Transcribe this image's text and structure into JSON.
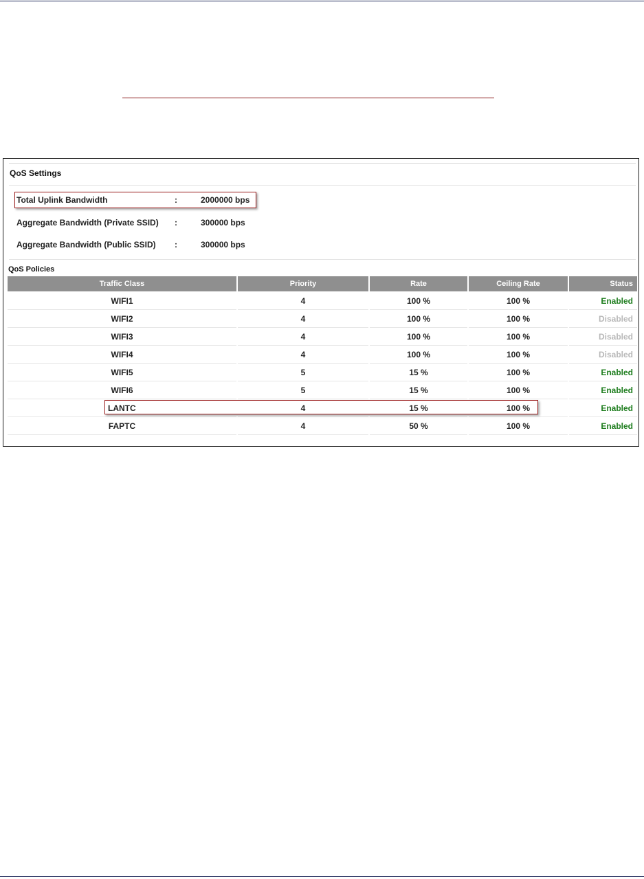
{
  "panel": {
    "title": "QoS Settings"
  },
  "settings": [
    {
      "label": "Total Uplink Bandwidth",
      "colon": ":",
      "value": "2000000 bps"
    },
    {
      "label": "Aggregate Bandwidth (Private SSID)",
      "colon": ":",
      "value": "300000 bps"
    },
    {
      "label": "Aggregate Bandwidth (Public SSID)",
      "colon": ":",
      "value": "300000 bps"
    }
  ],
  "policies": {
    "title": "QoS Policies",
    "columns": [
      "Traffic Class",
      "Priority",
      "Rate",
      "Ceiling Rate",
      "Status"
    ],
    "rows": [
      {
        "traffic_class": "WIFI1",
        "priority": "4",
        "rate": "100 %",
        "ceiling_rate": "100 %",
        "status": "Enabled"
      },
      {
        "traffic_class": "WIFI2",
        "priority": "4",
        "rate": "100 %",
        "ceiling_rate": "100 %",
        "status": "Disabled"
      },
      {
        "traffic_class": "WIFI3",
        "priority": "4",
        "rate": "100 %",
        "ceiling_rate": "100 %",
        "status": "Disabled"
      },
      {
        "traffic_class": "WIFI4",
        "priority": "4",
        "rate": "100 %",
        "ceiling_rate": "100 %",
        "status": "Disabled"
      },
      {
        "traffic_class": "WIFI5",
        "priority": "5",
        "rate": "15 %",
        "ceiling_rate": "100 %",
        "status": "Enabled"
      },
      {
        "traffic_class": "WIFI6",
        "priority": "5",
        "rate": "15 %",
        "ceiling_rate": "100 %",
        "status": "Enabled"
      },
      {
        "traffic_class": "LANTC",
        "priority": "4",
        "rate": "15 %",
        "ceiling_rate": "100 %",
        "status": "Enabled"
      },
      {
        "traffic_class": "FAPTC",
        "priority": "4",
        "rate": "50 %",
        "ceiling_rate": "100 %",
        "status": "Enabled"
      }
    ]
  },
  "colors": {
    "header_bg": "#8f8f8f",
    "enabled": "#1e7d1e",
    "disabled": "#b8b8b8",
    "highlight_border": "#9a1c1c"
  }
}
